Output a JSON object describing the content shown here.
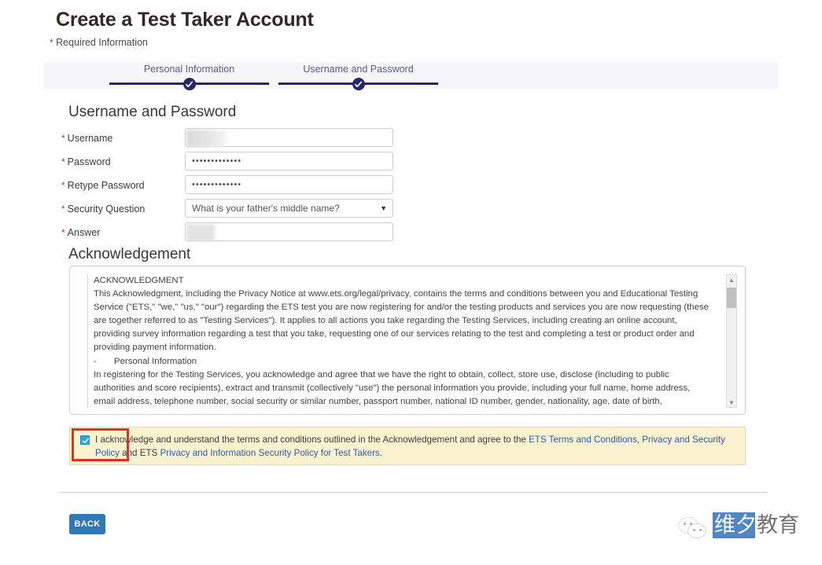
{
  "header": {
    "title": "Create a Test Taker Account",
    "required_note": "Required Information",
    "asterisk": "*"
  },
  "stepper": {
    "steps": [
      {
        "label": "Personal Information",
        "state": "complete",
        "icon": "check-icon"
      },
      {
        "label": "Username and Password",
        "state": "complete",
        "icon": "check-icon"
      }
    ]
  },
  "sections": {
    "username_password": "Username and Password",
    "acknowledgement": "Acknowledgement"
  },
  "form": {
    "fields": [
      {
        "label": "Username",
        "required": true,
        "type": "text",
        "value": "",
        "redacted": true
      },
      {
        "label": "Password",
        "required": true,
        "type": "password",
        "value": "•••••••••••••"
      },
      {
        "label": "Retype Password",
        "required": true,
        "type": "password",
        "value": "•••••••••••••"
      },
      {
        "label": "Security Question",
        "required": true,
        "type": "select",
        "value": "What is your father's middle name?",
        "caret": "chevron-down-icon"
      },
      {
        "label": "Answer",
        "required": true,
        "type": "text",
        "value": "",
        "redacted": true
      }
    ]
  },
  "acknowledgement": {
    "heading_line": "ACKNOWLEDGMENT",
    "paragraph1": "This Acknowledgment, including the Privacy Notice at www.ets.org/legal/privacy, contains the terms and conditions between you and Educational Testing Service (\"ETS,\" \"we,\" \"us,\" \"our\") regarding the ETS test you are now registering for and/or the testing products and services you are now requesting (these are together referred to as \"Testing Services\").  It applies to all actions you take regarding the Testing Services, including creating an online account, providing survey information regarding a test that you take, requesting one of our services relating to the test and completing a test or product order and providing payment information.",
    "bullet1_dash": "-",
    "bullet1": "Personal Information",
    "paragraph2": "In registering for the Testing Services, you acknowledge and agree that we have the right to obtain, collect, store use, disclose (including to public authorities and score recipients), extract and transmit (collectively \"use\") the personal information you provide, including your full name, home address, email address, telephone number, social security or similar number, passport number, national ID number, gender, nationality, age, date of birth,",
    "scrollbar": {
      "up_icon": "triangle-up-icon",
      "down_icon": "triangle-down-icon"
    }
  },
  "consent": {
    "checked": true,
    "check_icon": "check-icon",
    "text_before": "I acknowledge and understand the terms and conditions outlined in the Acknowledgement and agree to the ",
    "link1": "ETS Terms and Conditions",
    "separator": ", ",
    "link2": "Privacy and Security Policy",
    "text_middle": " and ETS ",
    "link3": "Privacy and Information Security Policy for Test Takers",
    "text_after": "."
  },
  "footer": {
    "back_label": "BACK"
  },
  "watermark": {
    "text_highlight": "维夕",
    "text_plain": "教育",
    "icon": "wechat-icon"
  },
  "colors": {
    "stepper_navy": "#262669",
    "required_red": "#c0392b",
    "link_blue": "#2a5fa8",
    "consent_bg": "#fbf2d0",
    "button_blue": "#3179b5",
    "annotation_red": "#ee2b20",
    "checkbox_cyan": "#2aa8df"
  }
}
